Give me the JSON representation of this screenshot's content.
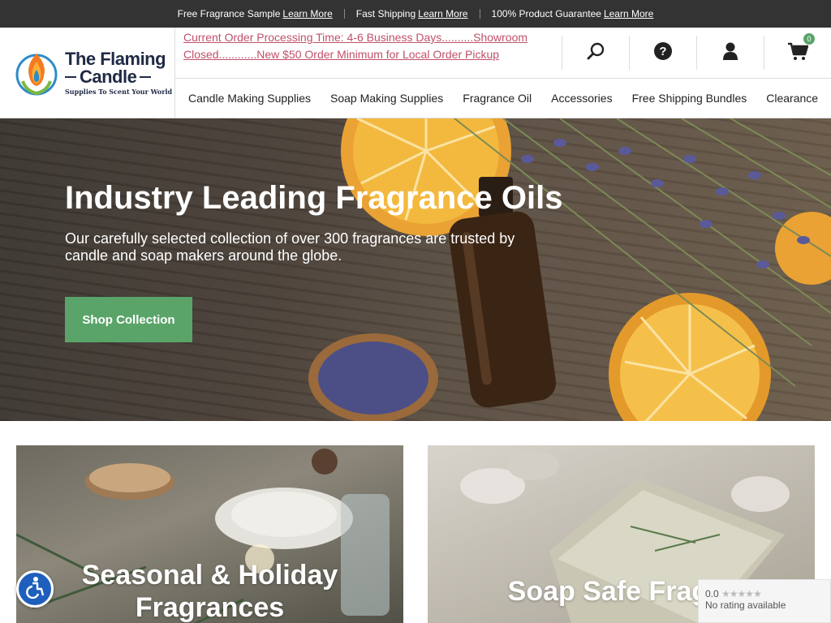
{
  "topbar": {
    "items": [
      {
        "text": "Free Fragrance Sample",
        "link": "Learn More"
      },
      {
        "text": "Fast Shipping",
        "link": "Learn More"
      },
      {
        "text": "100% Product Guarantee",
        "link": "Learn More"
      }
    ]
  },
  "logo": {
    "line1": "The Flaming",
    "line2": "Candle",
    "tagline": "Supplies To Scent Your World"
  },
  "notice": "Current Order Processing Time: 4-6 Business Days..........Showroom Closed............New $50 Order Minimum for Local Order Pickup",
  "header_icons": {
    "cart_count": "0"
  },
  "nav": {
    "items": [
      "Candle Making Supplies",
      "Soap Making Supplies",
      "Fragrance Oil",
      "Accessories",
      "Free Shipping Bundles",
      "Clearance"
    ]
  },
  "hero": {
    "title": "Industry Leading Fragrance Oils",
    "subtitle": "Our carefully selected collection of over 300 fragrances are trusted by candle and soap makers around the globe.",
    "button": "Shop Collection"
  },
  "cards": [
    {
      "title": "Seasonal & Holiday Fragrances"
    },
    {
      "title": "Soap Safe Fragra"
    }
  ],
  "rating_widget": {
    "score": "0.0",
    "stars": "★★★★★",
    "label": "No rating available"
  },
  "colors": {
    "accent": "#5aa469",
    "notice": "#c0506a",
    "topbar": "#333333",
    "a11y": "#1e5fbd"
  }
}
